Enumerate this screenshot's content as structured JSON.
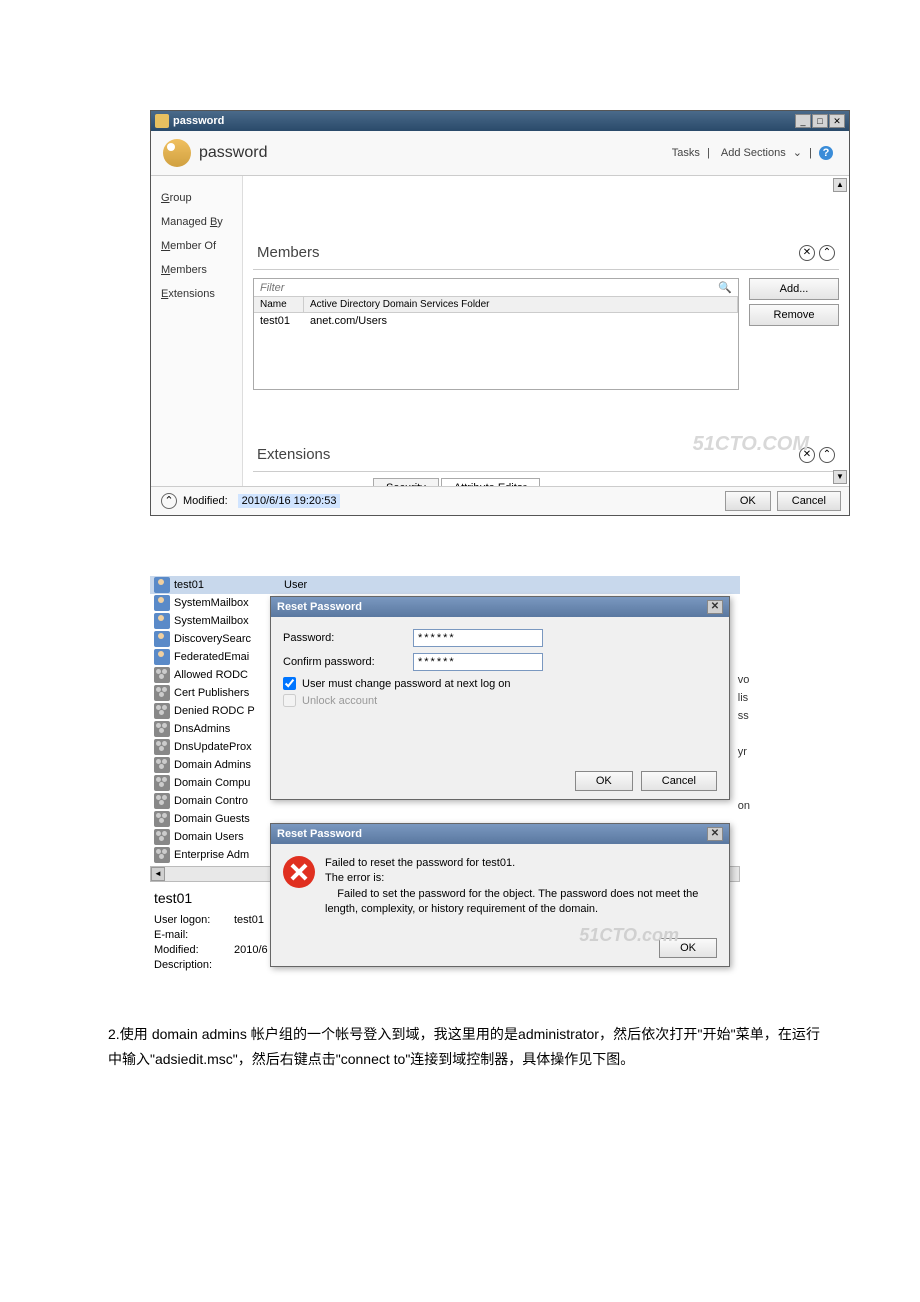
{
  "window1": {
    "title": "password",
    "headerTitle": "password",
    "actions": {
      "tasks": "Tasks",
      "addSections": "Add Sections"
    },
    "nav": {
      "group": "Group",
      "managedBy": "Managed By",
      "memberOf": "Member Of",
      "members": "Members",
      "extensions": "Extensions"
    },
    "members": {
      "title": "Members",
      "filterPlaceholder": "Filter",
      "columns": {
        "name": "Name",
        "folder": "Active Directory Domain Services Folder"
      },
      "rows": [
        {
          "name": "test01",
          "folder": "anet.com/Users"
        }
      ],
      "addBtn": "Add...",
      "removeBtn": "Remove"
    },
    "extensions": {
      "title": "Extensions",
      "tabs": {
        "security": "Security",
        "attributeEditor": "Attribute Editor"
      }
    },
    "footer": {
      "modifiedLabel": "Modified:",
      "modifiedValue": "2010/6/16 19:20:53",
      "ok": "OK",
      "cancel": "Cancel"
    },
    "watermark": "51CTO.COM"
  },
  "window2": {
    "list": [
      {
        "name": "test01",
        "type": "User",
        "icon": "person",
        "sel": true
      },
      {
        "name": "SystemMailbox",
        "type": "",
        "icon": "person"
      },
      {
        "name": "SystemMailbox",
        "type": "",
        "icon": "person"
      },
      {
        "name": "DiscoverySearc",
        "type": "",
        "icon": "person"
      },
      {
        "name": "FederatedEmai",
        "type": "",
        "icon": "person"
      },
      {
        "name": "Allowed RODC",
        "type": "",
        "icon": "group"
      },
      {
        "name": "Cert Publishers",
        "type": "",
        "icon": "group"
      },
      {
        "name": "Denied RODC P",
        "type": "",
        "icon": "group"
      },
      {
        "name": "DnsAdmins",
        "type": "",
        "icon": "group"
      },
      {
        "name": "DnsUpdateProx",
        "type": "",
        "icon": "group"
      },
      {
        "name": "Domain Admins",
        "type": "",
        "icon": "group"
      },
      {
        "name": "Domain Compu",
        "type": "",
        "icon": "group"
      },
      {
        "name": "Domain Contro",
        "type": "",
        "icon": "group"
      },
      {
        "name": "Domain Guests",
        "type": "",
        "icon": "group"
      },
      {
        "name": "Domain Users",
        "type": "",
        "icon": "group"
      },
      {
        "name": "Enterprise Adm",
        "type": "",
        "icon": "group"
      }
    ],
    "sideText": [
      "vo",
      "lis",
      "ss",
      "",
      "yr",
      "",
      "",
      "on"
    ],
    "resetDlg": {
      "title": "Reset Password",
      "passwordLabel": "Password:",
      "confirmLabel": "Confirm password:",
      "passwordVal": "******",
      "confirmVal": "******",
      "mustChange": "User must change password at next log on",
      "unlock": "Unlock account",
      "ok": "OK",
      "cancel": "Cancel"
    },
    "errorDlg": {
      "title": "Reset Password",
      "line1": "Failed to reset the password for test01.",
      "line2": "The error is:",
      "line3": "    Failed to set the password for the object. The password does not meet the length, complexity, or history requirement of the domain.",
      "ok": "OK"
    },
    "detail": {
      "title": "test01",
      "userLogonLabel": "User logon:",
      "userLogonVal": "test01",
      "emailLabel": "E-mail:",
      "modifiedLabel": "Modified:",
      "modifiedVal": "2010/6",
      "descriptionLabel": "Description:"
    },
    "watermark": "51CTO.com"
  },
  "paragraph": "2.使用 domain admins 帐户组的一个帐号登入到域，我这里用的是administrator，然后依次打开\"开始\"菜单，在运行中输入\"adsiedit.msc\"，然后右键点击\"connect to\"连接到域控制器，具体操作见下图。"
}
